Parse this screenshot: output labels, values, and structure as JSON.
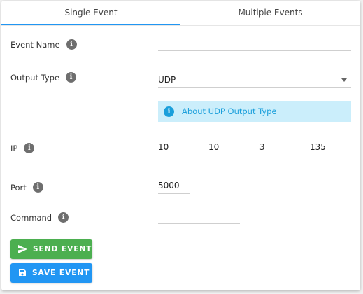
{
  "tabs": [
    {
      "label": "Single Event",
      "active": true
    },
    {
      "label": "Multiple Events",
      "active": false
    }
  ],
  "form": {
    "event_name": {
      "label": "Event Name",
      "value": ""
    },
    "output_type": {
      "label": "Output Type",
      "value": "UDP"
    },
    "about_link": "About UDP Output Type",
    "ip": {
      "label": "IP",
      "octets": [
        "10",
        "10",
        "3",
        "135"
      ]
    },
    "port": {
      "label": "Port",
      "value": "5000"
    },
    "command": {
      "label": "Command",
      "value": ""
    }
  },
  "buttons": {
    "send": "SEND EVENT",
    "save": "SAVE EVENT"
  },
  "icons": {
    "info": "info-icon",
    "send": "send-icon",
    "save": "floppy-disk-icon",
    "dropdown": "chevron-down-icon"
  },
  "colors": {
    "accent": "#2196f3",
    "send_button": "#4caf50",
    "save_button": "#2196f3",
    "info_banner_bg": "#cbeefb",
    "info_banner_text": "#1a9fdb"
  }
}
